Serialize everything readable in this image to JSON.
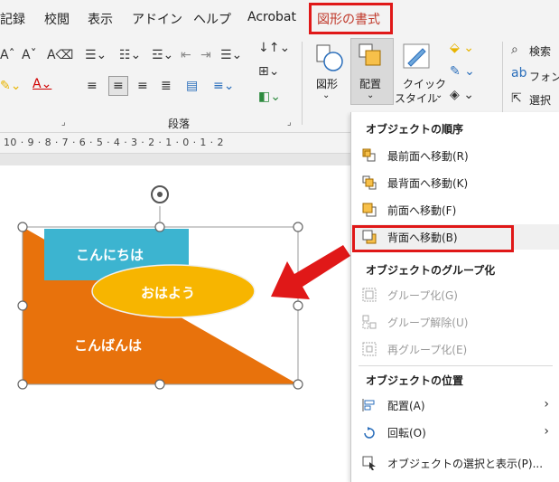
{
  "tabs": [
    {
      "label": "記録"
    },
    {
      "label": "校閲"
    },
    {
      "label": "表示"
    },
    {
      "label": "アドイン"
    },
    {
      "label": "ヘルプ"
    },
    {
      "label": "Acrobat"
    },
    {
      "label": "図形の書式"
    }
  ],
  "ribbon": {
    "paragraph_group_label": "段落",
    "shapes_label": "図形",
    "arrange_label": "配置",
    "quick_style_label_1": "クイック",
    "quick_style_label_2": "スタイル",
    "search_label": "検索",
    "font_label": "フォン",
    "select_label": "選択"
  },
  "ruler": {
    "text": "10 · 9 · 8 · 7 · 6 · 5 · 4 · 3 · 2 · 1 · 0 · 1 · 2"
  },
  "canvas": {
    "shape_cyan_text": "こんにちは",
    "shape_ellipse_text": "おはよう",
    "shape_triangle_text": "こんばんは"
  },
  "menu": {
    "section_order": "オブジェクトの順序",
    "bring_front": "最前面へ移動(R)",
    "send_back_most": "最背面へ移動(K)",
    "bring_forward": "前面へ移動(F)",
    "send_backward": "背面へ移動(B)",
    "section_group": "オブジェクトのグループ化",
    "group": "グループ化(G)",
    "ungroup": "グループ解除(U)",
    "regroup": "再グループ化(E)",
    "section_position": "オブジェクトの位置",
    "align": "配置(A)",
    "rotate": "回転(O)",
    "selection_pane": "オブジェクトの選択と表示(P)..."
  },
  "colors": {
    "accent_red": "#e01818",
    "orange": "#e8720c",
    "cyan": "#3cb4d0",
    "yellow": "#f7b500"
  }
}
